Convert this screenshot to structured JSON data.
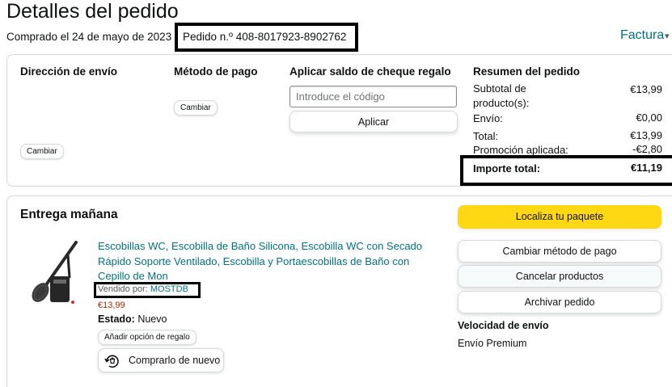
{
  "header": {
    "title": "Detalles del pedido",
    "order_date": "Comprado el 24 de mayo de 2023",
    "order_number": "Pedido n.º 408-8017923-8902762",
    "invoice": "Factura"
  },
  "shipping_address": {
    "title": "Dirección de envío",
    "change_label": "Cambiar"
  },
  "payment_method": {
    "title": "Método de pago",
    "change_label": "Cambiar"
  },
  "gift_card": {
    "title": "Aplicar saldo de cheque regalo",
    "placeholder": "Introduce el código",
    "apply_label": "Aplicar"
  },
  "summary": {
    "title": "Resumen del pedido",
    "rows": [
      {
        "label": "Subtotal de producto(s):",
        "value": "€13,99"
      },
      {
        "label": "Envío:",
        "value": "€0,00"
      },
      {
        "label": "Total:",
        "value": "€13,99"
      },
      {
        "label": "Promoción aplicada:",
        "value": "-€2,80"
      }
    ],
    "grand_total_label": "Importe total:",
    "grand_total_value": "€11,19"
  },
  "shipment": {
    "title": "Entrega mañana",
    "product_title": "Escobillas WC, Escobilla de Baño Silicona, Escobilla WC con Secado Rápido Soporte Ventilado, Escobilla y Portaescobillas de Baño con Cepillo de Mon",
    "sold_by_label": "Vendido por:",
    "seller": "MOSTDB",
    "price": "€13,99",
    "condition_label": "Estado:",
    "condition_value": "Nuevo",
    "gift_option_label": "Añadir opción de regalo",
    "buy_again_label": "Comprarlo de nuevo"
  },
  "actions": {
    "track": "Localiza tu paquete",
    "change_payment": "Cambiar método de pago",
    "cancel": "Cancelar productos",
    "archive": "Archivar pedido"
  },
  "shipping_speed": {
    "title": "Velocidad de envío",
    "value": "Envío Premium"
  },
  "colors": {
    "link": "#007185",
    "price": "#b12704",
    "primary_button": "#ffd814",
    "border": "#d5d9d9"
  },
  "icons": [
    "chevron-down-icon",
    "buy-again-icon",
    "product-thumbnail"
  ]
}
